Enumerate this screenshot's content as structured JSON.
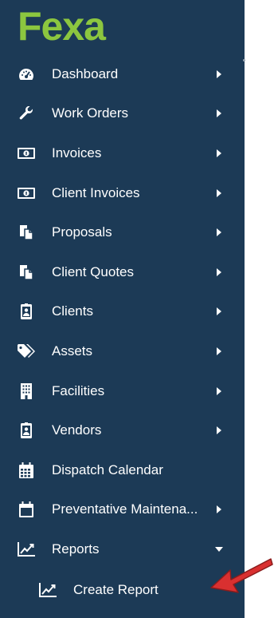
{
  "brand": {
    "logo_text": "Fexa",
    "logo_color": "#8cc63f"
  },
  "colors": {
    "sidebar_bg": "#1c3a56",
    "text": "#ffffff",
    "annotation_arrow": "#d93030"
  },
  "menu": [
    {
      "label": "Dashboard",
      "icon": "speedometer-icon",
      "caret": "right"
    },
    {
      "label": "Work Orders",
      "icon": "wrench-icon",
      "caret": "right"
    },
    {
      "label": "Invoices",
      "icon": "money-bill-icon",
      "caret": "right"
    },
    {
      "label": "Client Invoices",
      "icon": "money-bill-icon",
      "caret": "right"
    },
    {
      "label": "Proposals",
      "icon": "copy-document-icon",
      "caret": "right"
    },
    {
      "label": "Client Quotes",
      "icon": "copy-document-icon",
      "caret": "right"
    },
    {
      "label": "Clients",
      "icon": "id-badge-icon",
      "caret": "right"
    },
    {
      "label": "Assets",
      "icon": "tags-icon",
      "caret": "right"
    },
    {
      "label": "Facilities",
      "icon": "building-icon",
      "caret": "right"
    },
    {
      "label": "Vendors",
      "icon": "id-badge-icon",
      "caret": "right"
    },
    {
      "label": "Dispatch Calendar",
      "icon": "calendar-grid-icon",
      "caret": "none"
    },
    {
      "label": "Preventative Maintena...",
      "icon": "calendar-icon",
      "caret": "right"
    },
    {
      "label": "Reports",
      "icon": "line-chart-icon",
      "caret": "down",
      "expanded": true
    }
  ],
  "submenu": [
    {
      "label": "Create Report",
      "icon": "line-chart-icon"
    }
  ]
}
